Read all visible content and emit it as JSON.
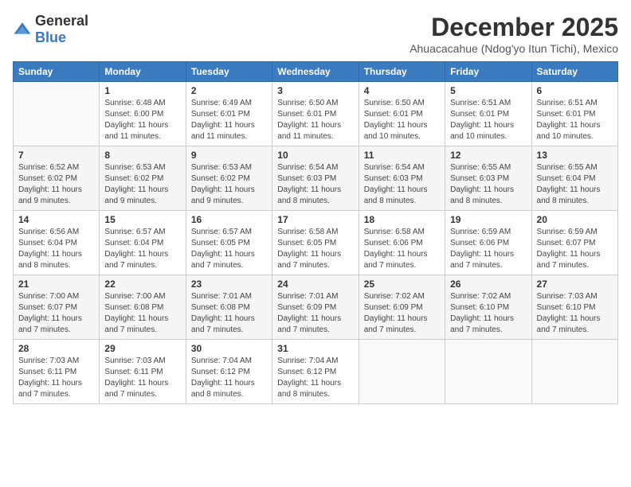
{
  "logo": {
    "general": "General",
    "blue": "Blue"
  },
  "title": "December 2025",
  "location": "Ahuacacahue (Ndog'yo Itun Tichi), Mexico",
  "days_of_week": [
    "Sunday",
    "Monday",
    "Tuesday",
    "Wednesday",
    "Thursday",
    "Friday",
    "Saturday"
  ],
  "weeks": [
    [
      {
        "day": "",
        "sunrise": "",
        "sunset": "",
        "daylight": ""
      },
      {
        "day": "1",
        "sunrise": "Sunrise: 6:48 AM",
        "sunset": "Sunset: 6:00 PM",
        "daylight": "Daylight: 11 hours and 11 minutes."
      },
      {
        "day": "2",
        "sunrise": "Sunrise: 6:49 AM",
        "sunset": "Sunset: 6:01 PM",
        "daylight": "Daylight: 11 hours and 11 minutes."
      },
      {
        "day": "3",
        "sunrise": "Sunrise: 6:50 AM",
        "sunset": "Sunset: 6:01 PM",
        "daylight": "Daylight: 11 hours and 11 minutes."
      },
      {
        "day": "4",
        "sunrise": "Sunrise: 6:50 AM",
        "sunset": "Sunset: 6:01 PM",
        "daylight": "Daylight: 11 hours and 10 minutes."
      },
      {
        "day": "5",
        "sunrise": "Sunrise: 6:51 AM",
        "sunset": "Sunset: 6:01 PM",
        "daylight": "Daylight: 11 hours and 10 minutes."
      },
      {
        "day": "6",
        "sunrise": "Sunrise: 6:51 AM",
        "sunset": "Sunset: 6:01 PM",
        "daylight": "Daylight: 11 hours and 10 minutes."
      }
    ],
    [
      {
        "day": "7",
        "sunrise": "Sunrise: 6:52 AM",
        "sunset": "Sunset: 6:02 PM",
        "daylight": "Daylight: 11 hours and 9 minutes."
      },
      {
        "day": "8",
        "sunrise": "Sunrise: 6:53 AM",
        "sunset": "Sunset: 6:02 PM",
        "daylight": "Daylight: 11 hours and 9 minutes."
      },
      {
        "day": "9",
        "sunrise": "Sunrise: 6:53 AM",
        "sunset": "Sunset: 6:02 PM",
        "daylight": "Daylight: 11 hours and 9 minutes."
      },
      {
        "day": "10",
        "sunrise": "Sunrise: 6:54 AM",
        "sunset": "Sunset: 6:03 PM",
        "daylight": "Daylight: 11 hours and 8 minutes."
      },
      {
        "day": "11",
        "sunrise": "Sunrise: 6:54 AM",
        "sunset": "Sunset: 6:03 PM",
        "daylight": "Daylight: 11 hours and 8 minutes."
      },
      {
        "day": "12",
        "sunrise": "Sunrise: 6:55 AM",
        "sunset": "Sunset: 6:03 PM",
        "daylight": "Daylight: 11 hours and 8 minutes."
      },
      {
        "day": "13",
        "sunrise": "Sunrise: 6:55 AM",
        "sunset": "Sunset: 6:04 PM",
        "daylight": "Daylight: 11 hours and 8 minutes."
      }
    ],
    [
      {
        "day": "14",
        "sunrise": "Sunrise: 6:56 AM",
        "sunset": "Sunset: 6:04 PM",
        "daylight": "Daylight: 11 hours and 8 minutes."
      },
      {
        "day": "15",
        "sunrise": "Sunrise: 6:57 AM",
        "sunset": "Sunset: 6:04 PM",
        "daylight": "Daylight: 11 hours and 7 minutes."
      },
      {
        "day": "16",
        "sunrise": "Sunrise: 6:57 AM",
        "sunset": "Sunset: 6:05 PM",
        "daylight": "Daylight: 11 hours and 7 minutes."
      },
      {
        "day": "17",
        "sunrise": "Sunrise: 6:58 AM",
        "sunset": "Sunset: 6:05 PM",
        "daylight": "Daylight: 11 hours and 7 minutes."
      },
      {
        "day": "18",
        "sunrise": "Sunrise: 6:58 AM",
        "sunset": "Sunset: 6:06 PM",
        "daylight": "Daylight: 11 hours and 7 minutes."
      },
      {
        "day": "19",
        "sunrise": "Sunrise: 6:59 AM",
        "sunset": "Sunset: 6:06 PM",
        "daylight": "Daylight: 11 hours and 7 minutes."
      },
      {
        "day": "20",
        "sunrise": "Sunrise: 6:59 AM",
        "sunset": "Sunset: 6:07 PM",
        "daylight": "Daylight: 11 hours and 7 minutes."
      }
    ],
    [
      {
        "day": "21",
        "sunrise": "Sunrise: 7:00 AM",
        "sunset": "Sunset: 6:07 PM",
        "daylight": "Daylight: 11 hours and 7 minutes."
      },
      {
        "day": "22",
        "sunrise": "Sunrise: 7:00 AM",
        "sunset": "Sunset: 6:08 PM",
        "daylight": "Daylight: 11 hours and 7 minutes."
      },
      {
        "day": "23",
        "sunrise": "Sunrise: 7:01 AM",
        "sunset": "Sunset: 6:08 PM",
        "daylight": "Daylight: 11 hours and 7 minutes."
      },
      {
        "day": "24",
        "sunrise": "Sunrise: 7:01 AM",
        "sunset": "Sunset: 6:09 PM",
        "daylight": "Daylight: 11 hours and 7 minutes."
      },
      {
        "day": "25",
        "sunrise": "Sunrise: 7:02 AM",
        "sunset": "Sunset: 6:09 PM",
        "daylight": "Daylight: 11 hours and 7 minutes."
      },
      {
        "day": "26",
        "sunrise": "Sunrise: 7:02 AM",
        "sunset": "Sunset: 6:10 PM",
        "daylight": "Daylight: 11 hours and 7 minutes."
      },
      {
        "day": "27",
        "sunrise": "Sunrise: 7:03 AM",
        "sunset": "Sunset: 6:10 PM",
        "daylight": "Daylight: 11 hours and 7 minutes."
      }
    ],
    [
      {
        "day": "28",
        "sunrise": "Sunrise: 7:03 AM",
        "sunset": "Sunset: 6:11 PM",
        "daylight": "Daylight: 11 hours and 7 minutes."
      },
      {
        "day": "29",
        "sunrise": "Sunrise: 7:03 AM",
        "sunset": "Sunset: 6:11 PM",
        "daylight": "Daylight: 11 hours and 7 minutes."
      },
      {
        "day": "30",
        "sunrise": "Sunrise: 7:04 AM",
        "sunset": "Sunset: 6:12 PM",
        "daylight": "Daylight: 11 hours and 8 minutes."
      },
      {
        "day": "31",
        "sunrise": "Sunrise: 7:04 AM",
        "sunset": "Sunset: 6:12 PM",
        "daylight": "Daylight: 11 hours and 8 minutes."
      },
      {
        "day": "",
        "sunrise": "",
        "sunset": "",
        "daylight": ""
      },
      {
        "day": "",
        "sunrise": "",
        "sunset": "",
        "daylight": ""
      },
      {
        "day": "",
        "sunrise": "",
        "sunset": "",
        "daylight": ""
      }
    ]
  ]
}
